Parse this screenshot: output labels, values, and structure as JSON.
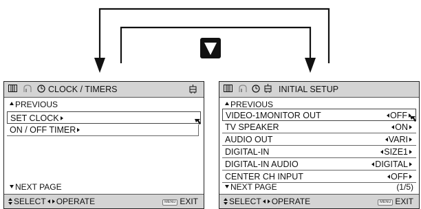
{
  "left_panel": {
    "header": {
      "title": "CLOCK / TIMERS",
      "icons": [
        "tv-screen-icon",
        "audio-icon",
        "clock-icon",
        "setup-icon"
      ]
    },
    "previous": "PREVIOUS",
    "items": [
      {
        "label": "SET CLOCK",
        "selected": true
      },
      {
        "label": "ON / OFF TIMER",
        "selected": false
      }
    ],
    "next_page": "NEXT PAGE",
    "footer": {
      "select_label": "SELECT",
      "operate_label": "OPERATE",
      "menu_tag": "MENU",
      "exit_label": "EXIT"
    }
  },
  "right_panel": {
    "header": {
      "title": "INITIAL SETUP",
      "icons": [
        "tv-screen-icon",
        "audio-icon",
        "clock-icon",
        "setup-icon"
      ]
    },
    "previous": "PREVIOUS",
    "items": [
      {
        "label": "VIDEO-1MONITOR OUT",
        "value": "OFF",
        "selected": true
      },
      {
        "label": "TV SPEAKER",
        "value": "ON",
        "selected": false
      },
      {
        "label": "AUDIO OUT",
        "value": "VARI",
        "selected": false
      },
      {
        "label": "DIGITAL-IN",
        "value": "SIZE1",
        "selected": false
      },
      {
        "label": "DIGITAL-IN AUDIO",
        "value": "DIGITAL",
        "selected": false
      },
      {
        "label": "CENTER CH INPUT",
        "value": "OFF",
        "selected": false
      }
    ],
    "next_page": "NEXT PAGE",
    "page_count": "(1/5)",
    "footer": {
      "select_label": "SELECT",
      "operate_label": "OPERATE",
      "menu_tag": "MENU",
      "exit_label": "EXIT"
    }
  },
  "navigation": {
    "center_icon": "down-arrow-icon",
    "connectors": [
      "left-arrow",
      "right-arrow"
    ]
  }
}
